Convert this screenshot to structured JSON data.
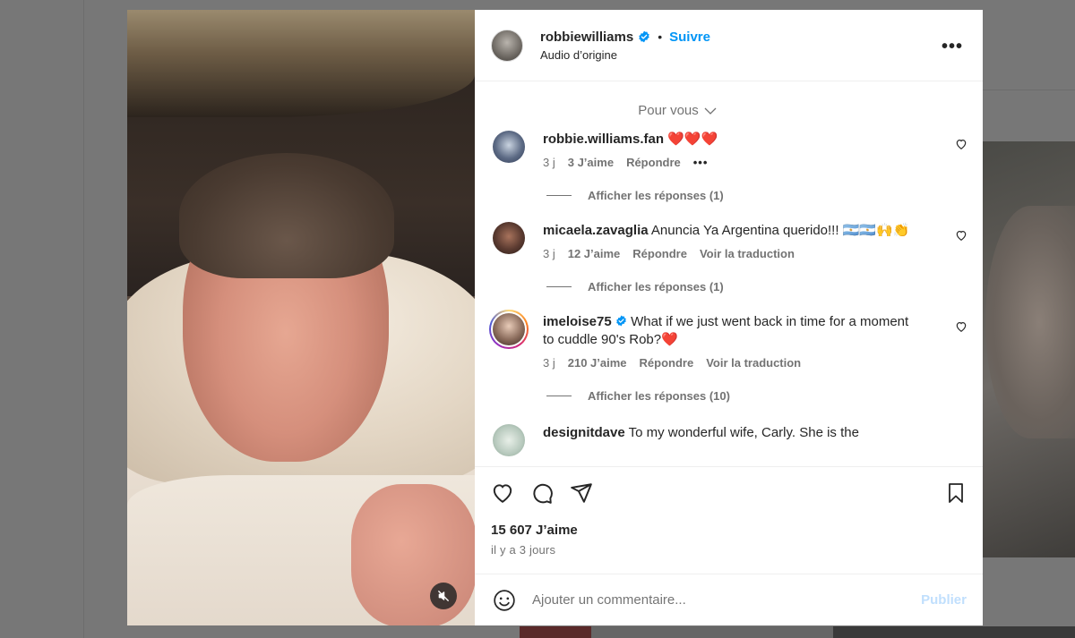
{
  "post": {
    "author": "robbiewilliams",
    "follow_label": "Suivre",
    "separator": "•",
    "audio": "Audio d’origine",
    "more": "•••"
  },
  "comments_section": {
    "sort_label": "Pour vous",
    "items": [
      {
        "user": "robbie.williams.fan",
        "text": "❤️❤️❤️",
        "age": "3 j",
        "likes": "3 J’aime",
        "reply": "Répondre",
        "extra": "•••",
        "replies": "Afficher les réponses (1)"
      },
      {
        "user": "micaela.zavaglia",
        "text": "Anuncia Ya Argentina querido!!! 🇦🇷🇦🇷🙌👏",
        "age": "3 j",
        "likes": "12 J’aime",
        "reply": "Répondre",
        "extra": "Voir la traduction",
        "replies": "Afficher les réponses (1)"
      },
      {
        "user": "imeloise75",
        "text": "What if we just went back in time for a moment to cuddle 90's Rob?❤️",
        "age": "3 j",
        "likes": "210 J’aime",
        "reply": "Répondre",
        "extra": "Voir la traduction",
        "replies": "Afficher les réponses (10)"
      },
      {
        "user": "designitdave",
        "text": "To my wonderful wife, Carly. She is the"
      }
    ]
  },
  "actions": {
    "likes_count": "15 607 J’aime",
    "posted_ago": "il y a 3 jours"
  },
  "compose": {
    "placeholder": "Ajouter un commentaire...",
    "publish_label": "Publier"
  },
  "colors": {
    "accent": "#0095f6",
    "publish_disabled": "#c0dffd",
    "verified": "#0095f6"
  }
}
